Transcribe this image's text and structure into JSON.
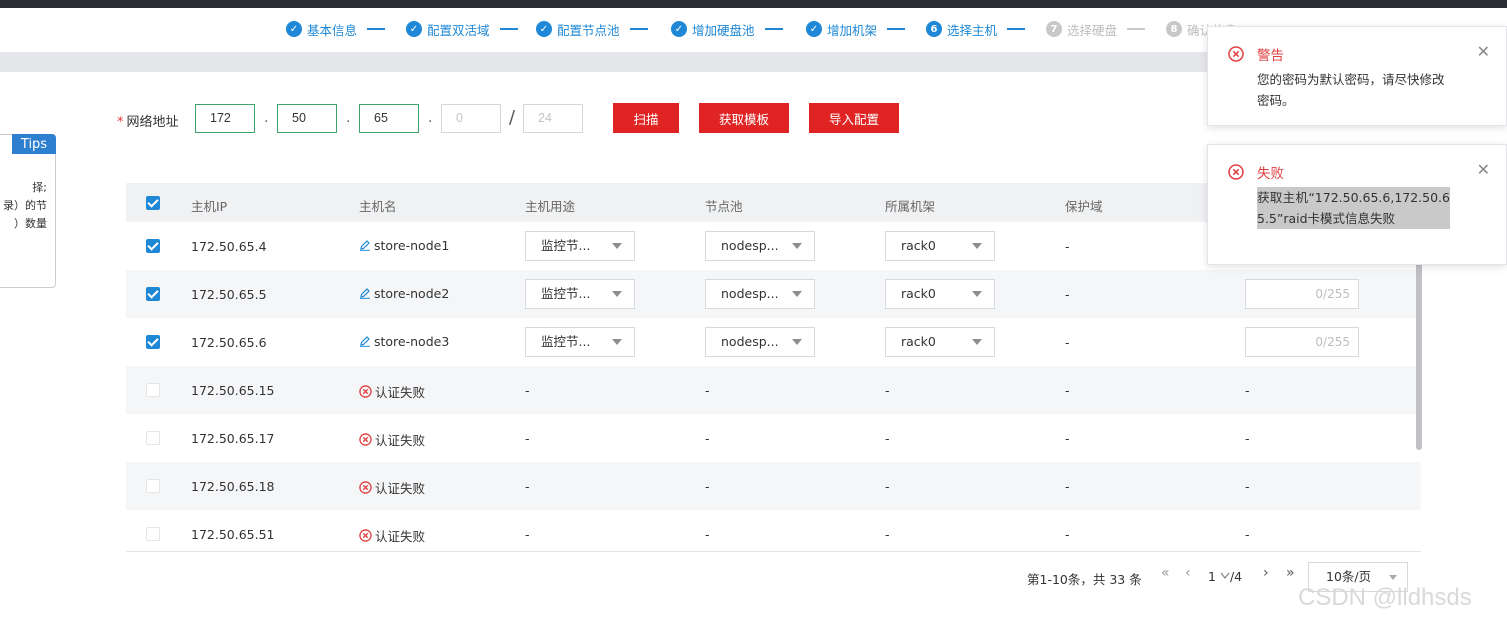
{
  "steps": [
    {
      "label": "基本信息",
      "status": "done",
      "num": ""
    },
    {
      "label": "配置双活域",
      "status": "done",
      "num": ""
    },
    {
      "label": "配置节点池",
      "status": "done",
      "num": ""
    },
    {
      "label": "增加硬盘池",
      "status": "done",
      "num": ""
    },
    {
      "label": "增加机架",
      "status": "done",
      "num": ""
    },
    {
      "label": "选择主机",
      "status": "current",
      "num": "6"
    },
    {
      "label": "选择硬盘",
      "status": "todo",
      "num": "7"
    },
    {
      "label": "确认信息",
      "status": "todo",
      "num": "8"
    }
  ],
  "tips": {
    "title": "Tips",
    "lines": [
      "择;",
      "录）的节",
      "）数量"
    ]
  },
  "network": {
    "label": "网络地址",
    "required_mark": "*",
    "octets": [
      "172",
      "50",
      "65"
    ],
    "octet4_placeholder": "0",
    "mask_placeholder": "24",
    "separator": ".",
    "slash": "/"
  },
  "actions": {
    "scan": "扫描",
    "get_template": "获取模板",
    "import_config": "导入配置"
  },
  "table": {
    "columns": [
      "主机IP",
      "主机名",
      "主机用途",
      "节点池",
      "所属机架",
      "保护域"
    ],
    "rows": [
      {
        "checked": true,
        "ip": "172.50.65.4",
        "name": "store-node1",
        "auth_fail": false,
        "usage": "监控节...",
        "pool": "nodesp...",
        "rack": "rack0",
        "domain": "-",
        "count": ""
      },
      {
        "checked": true,
        "ip": "172.50.65.5",
        "name": "store-node2",
        "auth_fail": false,
        "usage": "监控节...",
        "pool": "nodesp...",
        "rack": "rack0",
        "domain": "-",
        "count": "0/255"
      },
      {
        "checked": true,
        "ip": "172.50.65.6",
        "name": "store-node3",
        "auth_fail": false,
        "usage": "监控节...",
        "pool": "nodesp...",
        "rack": "rack0",
        "domain": "-",
        "count": "0/255"
      },
      {
        "checked": false,
        "ip": "172.50.65.15",
        "name": "认证失败",
        "auth_fail": true,
        "usage": "-",
        "pool": "-",
        "rack": "-",
        "domain": "-",
        "count": "-"
      },
      {
        "checked": false,
        "ip": "172.50.65.17",
        "name": "认证失败",
        "auth_fail": true,
        "usage": "-",
        "pool": "-",
        "rack": "-",
        "domain": "-",
        "count": "-"
      },
      {
        "checked": false,
        "ip": "172.50.65.18",
        "name": "认证失败",
        "auth_fail": true,
        "usage": "-",
        "pool": "-",
        "rack": "-",
        "domain": "-",
        "count": "-"
      },
      {
        "checked": false,
        "ip": "172.50.65.51",
        "name": "认证失败",
        "auth_fail": true,
        "usage": "-",
        "pool": "-",
        "rack": "-",
        "domain": "-",
        "count": "-"
      }
    ]
  },
  "pagination": {
    "summary": "第1-10条，共 33 条",
    "first": "«",
    "prev": "‹",
    "current": "1",
    "total": "/4",
    "next": "›",
    "last": "»",
    "page_size": "10条/页"
  },
  "toasts": {
    "warning": {
      "title": "警告",
      "message": "您的密码为默认密码，请尽快修改密码。"
    },
    "error": {
      "title": "失败",
      "message": "获取主机“172.50.65.6,172.50.65.5”raid卡模式信息失败"
    }
  },
  "watermark": "CSDN @lldhsds",
  "colors": {
    "accent": "#1e88d6",
    "danger": "#e02424",
    "error_text": "#e04040"
  },
  "icons": [
    "check-circle-icon",
    "edit-pen-icon",
    "error-circle-icon",
    "close-icon",
    "chevron-down-icon"
  ]
}
